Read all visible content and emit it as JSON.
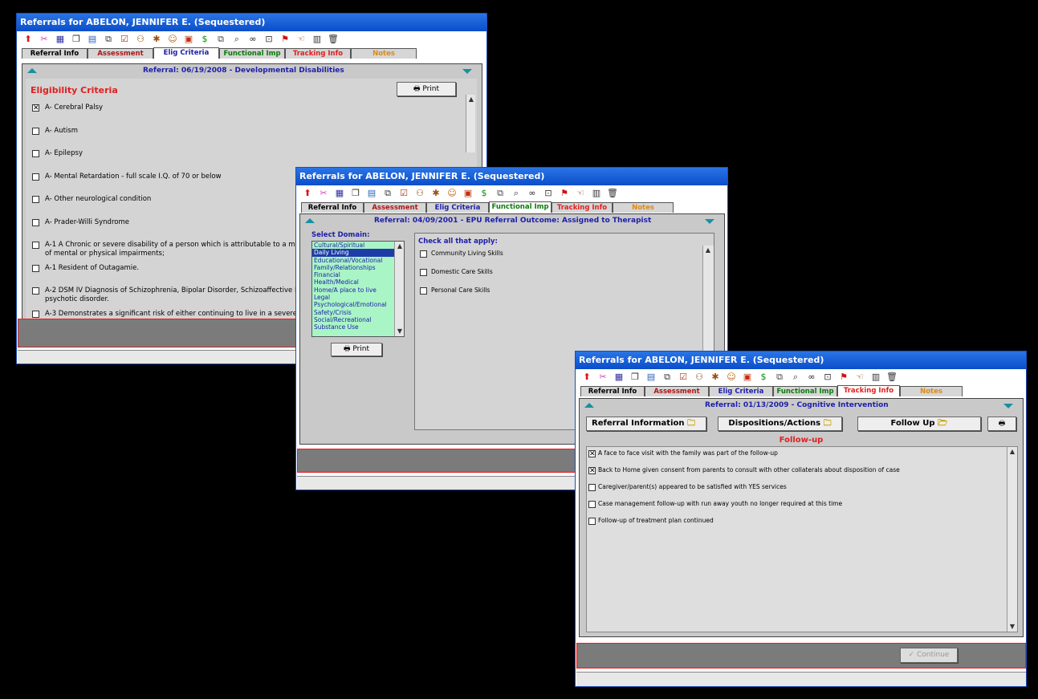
{
  "tabs": [
    "Referral Info",
    "Assessment",
    "Elig Criteria",
    "Functional Imp",
    "Tracking Info",
    "Notes"
  ],
  "tab_colors": [
    "#000000",
    "#b01515",
    "#1e1ea8",
    "#0c7a0c",
    "#e02020",
    "#e08a10"
  ],
  "toolbar_icons": [
    "up-arrow-icon",
    "scissors-icon",
    "grid-icon",
    "window-icon",
    "document-icon",
    "copy-icon",
    "checklist-icon",
    "people-icon",
    "tags-icon",
    "face-icon",
    "book-icon",
    "dollar-icon",
    "duplicate-icon",
    "search-doc-icon",
    "binoculars-icon",
    "lock-doc-icon",
    "red-flag-icon",
    "hand-pointer-icon",
    "columns-icon",
    "trash-icon"
  ],
  "win1": {
    "title": "Referrals for ABELON, JENNIFER E. (Sequestered)",
    "referral_bar": "Referral:   06/19/2008  -  Developmental Disabilities",
    "print_label": "Print",
    "section_title": "Eligibility Criteria",
    "criteria": [
      {
        "label": "A- Cerebral Palsy",
        "checked": true
      },
      {
        "label": "A- Autism",
        "checked": false
      },
      {
        "label": "A- Epilepsy",
        "checked": false
      },
      {
        "label": "A- Mental Retardation - full scale I.Q. of 70 or below",
        "checked": false
      },
      {
        "label": "A- Other neurological condition",
        "checked": false
      },
      {
        "label": "A- Prader-Willi Syndrome",
        "checked": false
      },
      {
        "label": "A-1   A Chronic or severe disability of a person which is attributable to a mental or",
        "label2": "of mental or physical impairments;",
        "checked": false
      },
      {
        "label": "A-1 Resident of Outagamie.",
        "checked": false
      },
      {
        "label": "A-2 DSM IV Diagnosis of Schizophrenia, Bipolar Disorder, Schizoaffective Disorder",
        "label2": "psychotic disorder.",
        "checked": false
      },
      {
        "label": "A-3 Demonstrates a significant risk of either continuing to live in a severely dysf",
        "checked": false
      }
    ]
  },
  "win2": {
    "title": "Referrals for ABELON, JENNIFER E. (Sequestered)",
    "referral_bar": "Referral:   04/09/2001  -  EPU      Referral Outcome:  Assigned to Therapist",
    "select_domain_label": "Select Domain:",
    "domains": [
      "Cultural/Spiritual",
      "Daily Living",
      "Educational/Vocational",
      "Family/Relationships",
      "Financial",
      "Health/Medical",
      "Home/A place to live",
      "Legal",
      "Psychological/Emotional",
      "Safety/Crisis",
      "Social/Recreational",
      "Substance Use"
    ],
    "selected_domain": 1,
    "print_label": "Print",
    "check_all_label": "Check all that apply:",
    "skills": [
      "Community Living Skills",
      "Domestic Care Skills",
      "Personal Care Skills"
    ]
  },
  "win3": {
    "title": "Referrals for ABELON, JENNIFER E. (Sequestered)",
    "referral_bar": "Referral:  01/13/2009  -  Cognitive Intervention",
    "subtabs": [
      "Referral Information",
      "Dispositions/Actions",
      "Follow Up"
    ],
    "followup_title": "Follow-up",
    "items": [
      {
        "label": "A face to face visit with the family was part of the follow-up",
        "checked": true
      },
      {
        "label": "Back to Home given consent from parents to consult with other collaterals about disposition of case",
        "checked": true
      },
      {
        "label": "Caregiver/parent(s) appeared to be satisfied with YES services",
        "checked": false
      },
      {
        "label": "Case management follow-up with run away youth no longer required at this time",
        "checked": false
      },
      {
        "label": "Follow-up of treatment plan continued",
        "checked": false
      }
    ],
    "continue_label": "Continue"
  }
}
